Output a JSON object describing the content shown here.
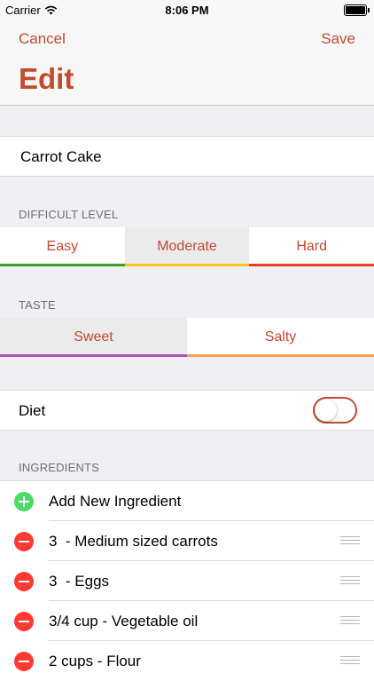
{
  "status_bar": {
    "carrier": "Carrier",
    "time": "8:06 PM"
  },
  "nav": {
    "cancel": "Cancel",
    "save": "Save",
    "title": "Edit"
  },
  "recipe": {
    "name": "Carrot Cake"
  },
  "difficulty": {
    "header": "DIFFICULT LEVEL",
    "options": [
      {
        "label": "Easy",
        "color": "#3e9b2e"
      },
      {
        "label": "Moderate",
        "color": "#f5c52a"
      },
      {
        "label": "Hard",
        "color": "#f03a2f"
      }
    ],
    "selected": "Moderate"
  },
  "taste": {
    "header": "TASTE",
    "options": [
      {
        "label": "Sweet",
        "color": "#a356b3"
      },
      {
        "label": "Salty",
        "color": "#f4a24f"
      }
    ],
    "selected": "Sweet"
  },
  "diet": {
    "label": "Diet",
    "on": false
  },
  "ingredients": {
    "header": "INGREDIENTS",
    "add_label": "Add New Ingredient",
    "items": [
      "3  - Medium sized carrots",
      "3  - Eggs",
      "3/4 cup - Vegetable oil",
      "2 cups - Flour"
    ]
  },
  "colors": {
    "accent": "#c24a2e",
    "add": "#4cd964",
    "remove": "#ff3b30"
  }
}
